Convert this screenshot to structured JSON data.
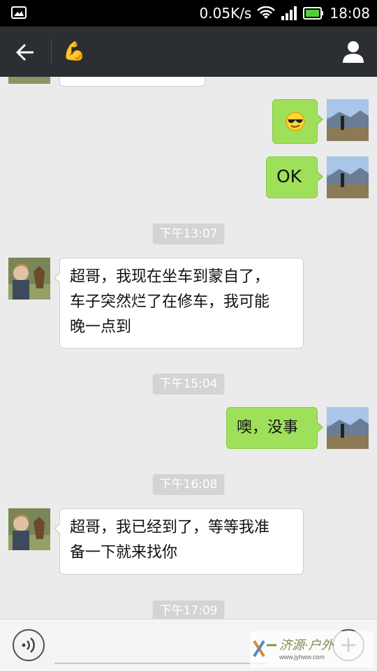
{
  "status_bar": {
    "speed": "0.05K/s",
    "time": "18:08",
    "icons": [
      "gallery-icon",
      "wifi-icon",
      "signal-icon",
      "battery-icon"
    ]
  },
  "header": {
    "title_emoji": "💪",
    "icons": [
      "back-arrow-icon",
      "profile-icon"
    ]
  },
  "messages": [
    {
      "type": "in",
      "text": "",
      "partial": true
    },
    {
      "type": "out",
      "emoji": "sunglasses-face-icon"
    },
    {
      "type": "out",
      "text": "OK"
    },
    {
      "type": "time",
      "text": "下午13:07"
    },
    {
      "type": "in",
      "lines": [
        "超哥，我现在坐车到蒙自了，",
        "车子突然烂了在修车，我可能",
        "晚一点到"
      ]
    },
    {
      "type": "time",
      "text": "下午15:04"
    },
    {
      "type": "out",
      "text": "噢，没事"
    },
    {
      "type": "time",
      "text": "下午16:08"
    },
    {
      "type": "in",
      "lines": [
        "超哥，我已经到了，等等我准",
        "备一下就来找你"
      ]
    },
    {
      "type": "time",
      "text": "下午17:09"
    }
  ],
  "input_bar": {
    "placeholder": "",
    "icons": [
      "voice-icon",
      "plus-icon"
    ]
  },
  "watermark": {
    "text": "济源·户外",
    "url": "www.jyhww.com"
  },
  "colors": {
    "header_bg": "#2b2e33",
    "chat_bg": "#ebebeb",
    "outgoing_bubble": "#9fe05a",
    "incoming_bubble": "#ffffff",
    "timestamp_bg": "#d4d4d4"
  }
}
